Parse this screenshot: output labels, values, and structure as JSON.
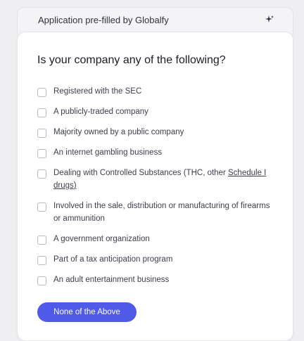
{
  "banner": {
    "text": "Application pre-filled by Globalfy",
    "icon": "sparkle-icon"
  },
  "question": "Is your company any of the following?",
  "options": [
    {
      "label": "Registered with the SEC",
      "checked": false
    },
    {
      "label": "A publicly-traded company",
      "checked": false
    },
    {
      "label": "Majority owned by a public company",
      "checked": false
    },
    {
      "label": "An internet gambling business",
      "checked": false
    },
    {
      "label": "Dealing with Controlled Substances (THC, other ",
      "link": "Schedule I drugs)",
      "checked": false
    },
    {
      "label": "Involved in the sale, distribution or manufacturing of firearms or ammunition",
      "checked": false
    },
    {
      "label": "A government organization",
      "checked": false
    },
    {
      "label": "Part of a tax anticipation program",
      "checked": false
    },
    {
      "label": "An adult entertainment business",
      "checked": false
    }
  ],
  "none_button": "None of the Above"
}
